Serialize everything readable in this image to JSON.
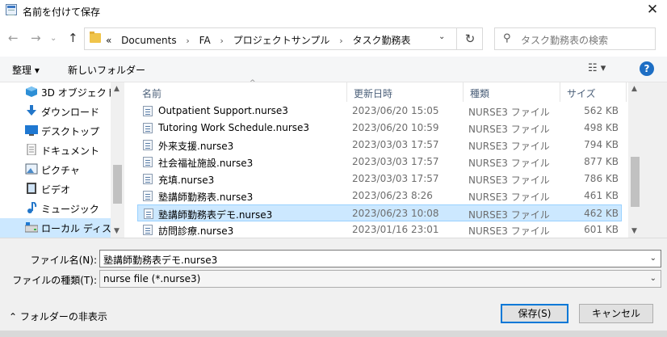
{
  "window": {
    "title": "名前を付けて保存",
    "close": "✕"
  },
  "nav": {
    "back": "←",
    "forward": "→",
    "up": "↑",
    "recent": "⌄"
  },
  "address": {
    "overflow": "«",
    "crumbs": [
      "Documents",
      "FA",
      "プロジェクトサンプル",
      "タスク勤務表"
    ],
    "separator": "›",
    "dropdown": "⌄",
    "refresh": "↻"
  },
  "search": {
    "icon": "⚲",
    "placeholder": "タスク勤務表の検索"
  },
  "toolbar": {
    "organize": "整理 ▾",
    "new_folder": "新しいフォルダー",
    "view_icon": "☷ ▾",
    "help": "?"
  },
  "sidebar": {
    "items": [
      {
        "label": "3D オブジェクト",
        "icon": "3d-objects-icon"
      },
      {
        "label": "ダウンロード",
        "icon": "download-icon"
      },
      {
        "label": "デスクトップ",
        "icon": "desktop-icon"
      },
      {
        "label": "ドキュメント",
        "icon": "documents-icon"
      },
      {
        "label": "ピクチャ",
        "icon": "pictures-icon"
      },
      {
        "label": "ビデオ",
        "icon": "videos-icon"
      },
      {
        "label": "ミュージック",
        "icon": "music-icon"
      },
      {
        "label": "ローカル ディスク (C",
        "icon": "local-disk-icon"
      }
    ]
  },
  "columns": {
    "name": "名前",
    "date": "更新日時",
    "type": "種類",
    "size": "サイズ",
    "sort_arrow": "^"
  },
  "files": [
    {
      "name": "Outpatient Support.nurse3",
      "date": "2023/06/20 15:05",
      "type": "NURSE3 ファイル",
      "size": "562 KB"
    },
    {
      "name": "Tutoring Work Schedule.nurse3",
      "date": "2023/06/20 10:59",
      "type": "NURSE3 ファイル",
      "size": "498 KB"
    },
    {
      "name": "外来支援.nurse3",
      "date": "2023/03/03 17:57",
      "type": "NURSE3 ファイル",
      "size": "794 KB"
    },
    {
      "name": "社会福祉施設.nurse3",
      "date": "2023/03/03 17:57",
      "type": "NURSE3 ファイル",
      "size": "877 KB"
    },
    {
      "name": "充填.nurse3",
      "date": "2023/03/03 17:57",
      "type": "NURSE3 ファイル",
      "size": "786 KB"
    },
    {
      "name": "塾講師勤務表.nurse3",
      "date": "2023/06/23 8:26",
      "type": "NURSE3 ファイル",
      "size": "461 KB"
    },
    {
      "name": "塾講師勤務表デモ.nurse3",
      "date": "2023/06/23 10:08",
      "type": "NURSE3 ファイル",
      "size": "462 KB"
    },
    {
      "name": "訪問診療.nurse3",
      "date": "2023/01/16 23:01",
      "type": "NURSE3 ファイル",
      "size": "601 KB"
    }
  ],
  "form": {
    "filename_label": "ファイル名(N):",
    "filename_value": "塾講師勤務表デモ.nurse3",
    "filetype_label": "ファイルの種類(T):",
    "filetype_value": "nurse file (*.nurse3)",
    "dropdown": "⌄",
    "hide_folders": "⌃ フォルダーの非表示",
    "save": "保存(S)",
    "cancel": "キャンセル"
  },
  "scrollbar": {
    "up": "▲",
    "down": "▼"
  }
}
